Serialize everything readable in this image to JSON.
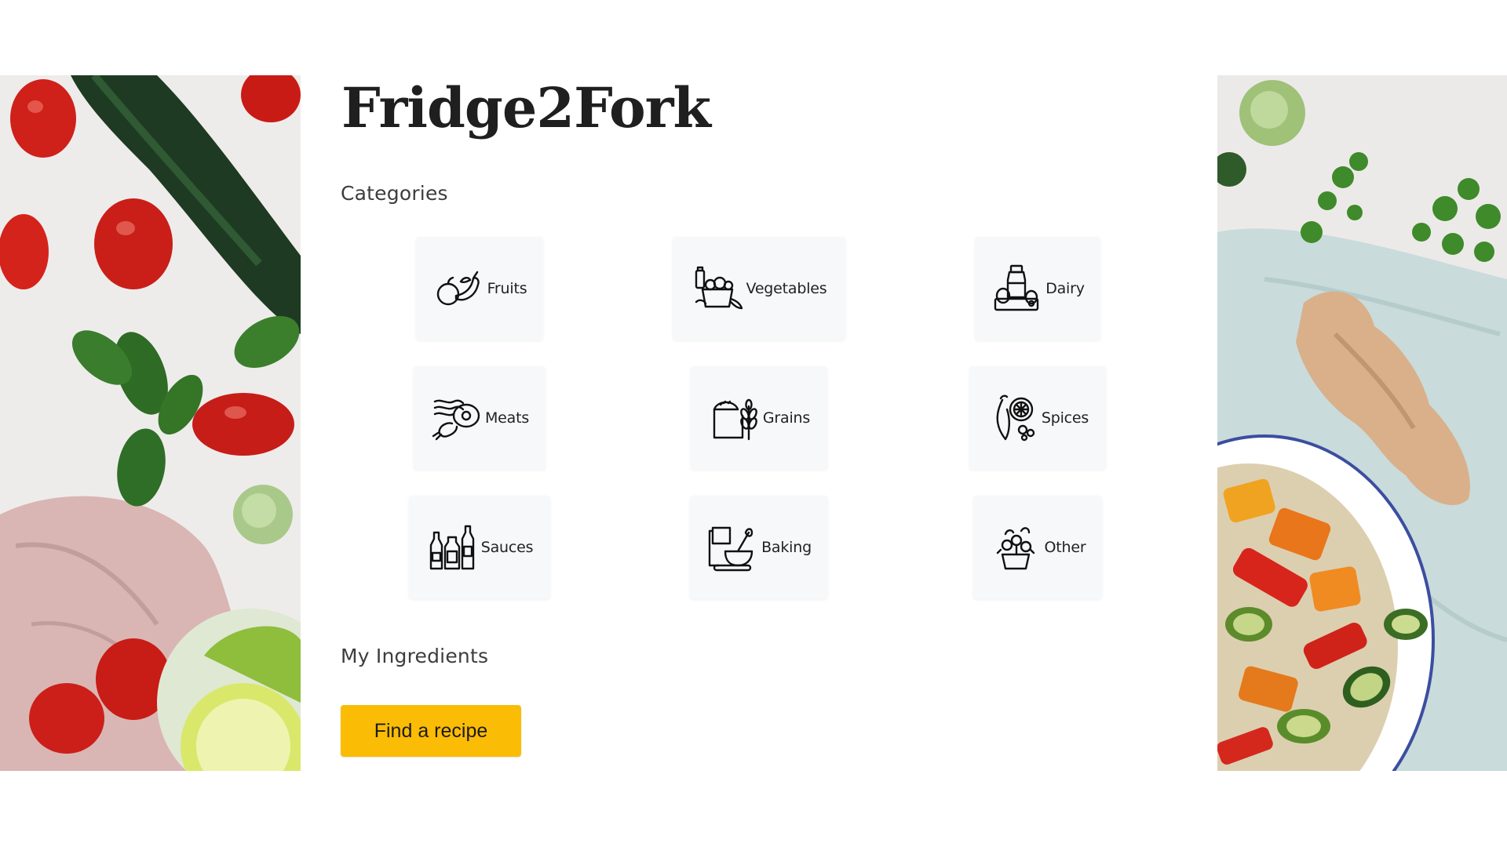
{
  "app": {
    "title": "Fridge2Fork"
  },
  "categories": {
    "heading": "Categories",
    "items": [
      {
        "label": "Fruits",
        "icon": "fruits-icon"
      },
      {
        "label": "Vegetables",
        "icon": "vegetables-icon"
      },
      {
        "label": "Dairy",
        "icon": "dairy-icon"
      },
      {
        "label": "Meats",
        "icon": "meats-icon"
      },
      {
        "label": "Grains",
        "icon": "grains-icon"
      },
      {
        "label": "Spices",
        "icon": "spices-icon"
      },
      {
        "label": "Sauces",
        "icon": "sauces-icon"
      },
      {
        "label": "Baking",
        "icon": "baking-icon"
      },
      {
        "label": "Other",
        "icon": "other-icon"
      }
    ]
  },
  "ingredients": {
    "heading": "My Ingredients"
  },
  "actions": {
    "find_recipe_label": "Find a recipe"
  },
  "colors": {
    "accent": "#fbbc05",
    "card_background": "#f7f8fa",
    "text": "#222222"
  }
}
